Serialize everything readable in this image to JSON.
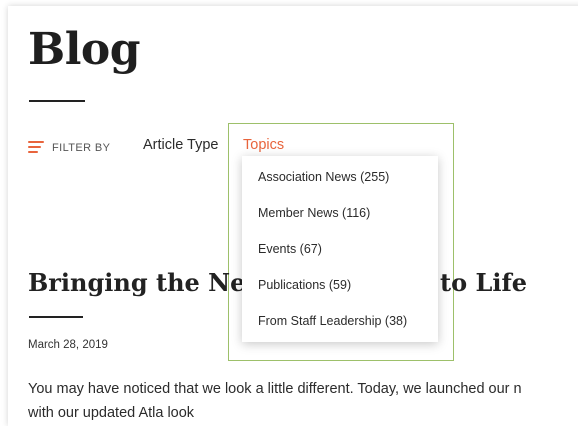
{
  "page": {
    "title": "Blog"
  },
  "filter": {
    "label": "FILTER BY",
    "tabs": [
      {
        "label": "Article Type",
        "active": false
      },
      {
        "label": "Topics",
        "active": true
      }
    ],
    "dropdown_items": [
      "Association News (255)",
      "Member News (116)",
      "Events (67)",
      "Publications (59)",
      "From Staff Leadership (38)"
    ]
  },
  "post": {
    "title_left": "Bringing the Ne",
    "title_right": "to Life",
    "date": "March 28, 2019",
    "excerpt_line1": "You may have noticed that we look a little different. Today, we launched our n",
    "excerpt_line2": "with our updated Atla look"
  },
  "colors": {
    "accent": "#e8643c",
    "highlight_border": "#9dc06a",
    "text": "#2b2b2b"
  },
  "icons": {
    "filter": "hamburger-icon"
  }
}
